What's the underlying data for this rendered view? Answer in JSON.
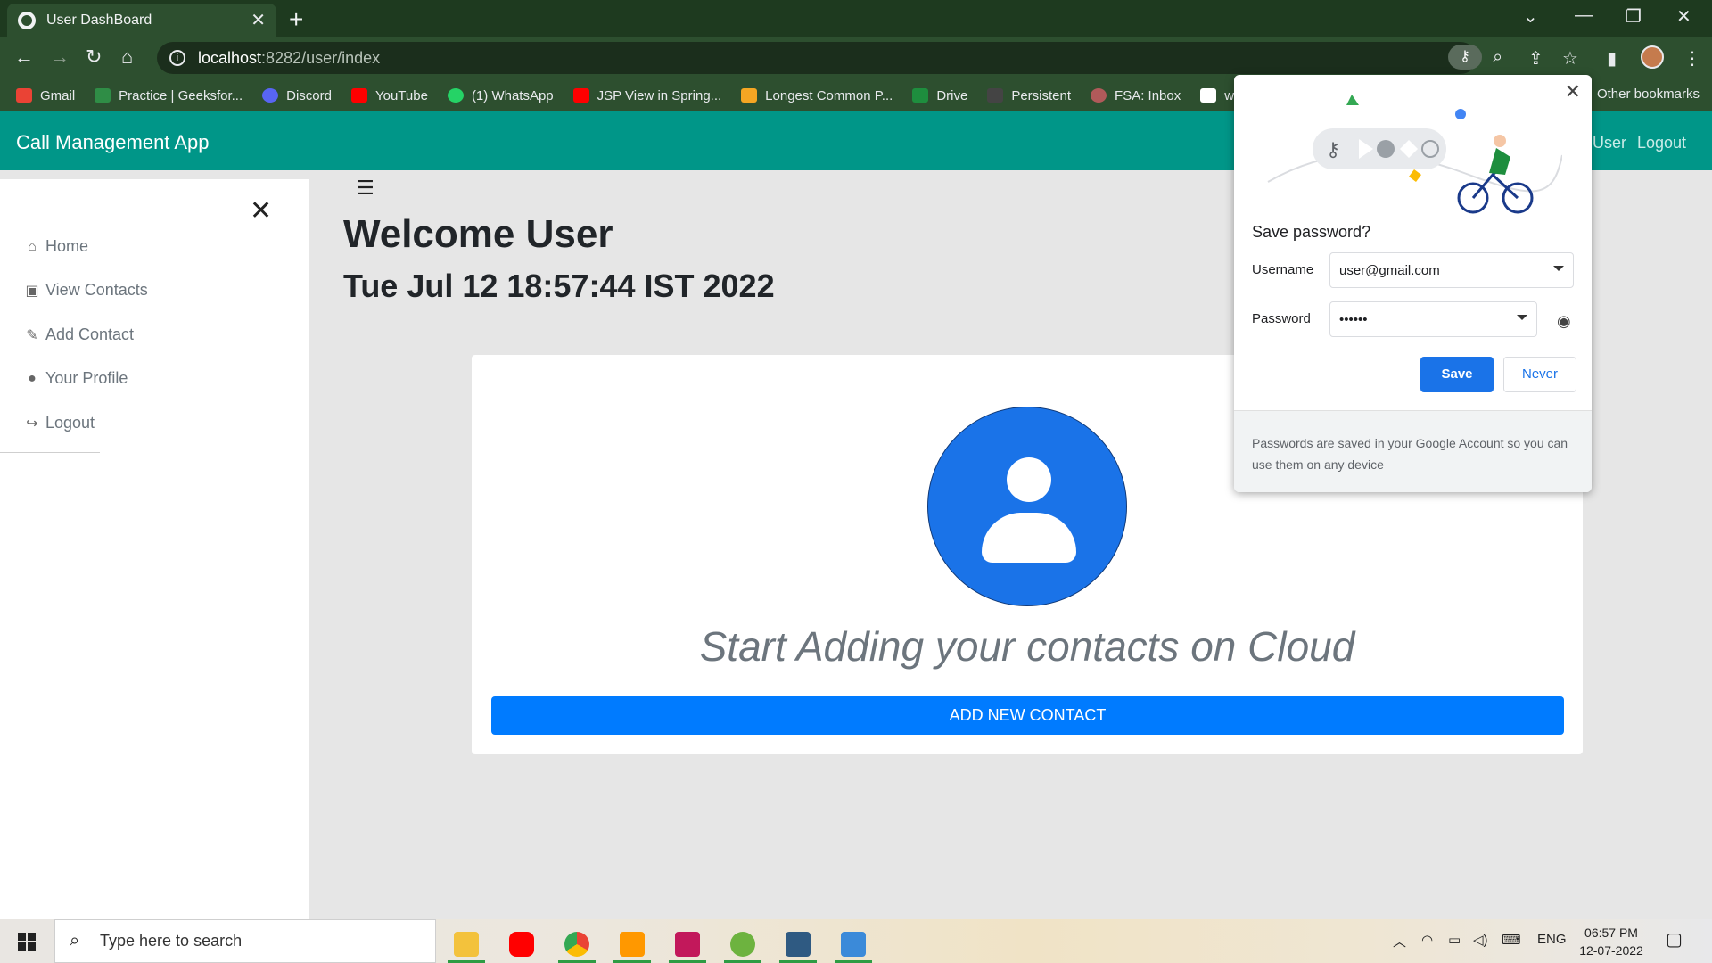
{
  "browser": {
    "tab_title": "User DashBoard",
    "url_host": "localhost",
    "url_path": ":8282/user/index",
    "bookmarks": [
      {
        "label": "Gmail",
        "color": "#ea4335"
      },
      {
        "label": "Practice | Geeksfor...",
        "color": "#2f8d46"
      },
      {
        "label": "Discord",
        "color": "#5865f2"
      },
      {
        "label": "YouTube",
        "color": "#ff0000"
      },
      {
        "label": "(1) WhatsApp",
        "color": "#25d366"
      },
      {
        "label": "JSP View in Spring...",
        "color": "#ff0000"
      },
      {
        "label": "Longest Common P...",
        "color": "#f5a623"
      },
      {
        "label": "Drive",
        "color": "#1e8e3e"
      },
      {
        "label": "Persistent",
        "color": "#444444"
      },
      {
        "label": "FSA: Inbox",
        "color": "#b05a5a"
      },
      {
        "label": "wi",
        "color": "#ffffff"
      }
    ],
    "other_bookmarks": "Other bookmarks"
  },
  "app": {
    "brand": "Call Management App",
    "nav_user": "User",
    "nav_logout": "Logout",
    "accent_color": "#009688"
  },
  "sidebar": {
    "items": [
      {
        "label": "Home",
        "icon": "home-icon"
      },
      {
        "label": "View Contacts",
        "icon": "contacts-icon"
      },
      {
        "label": "Add Contact",
        "icon": "pencil-icon"
      },
      {
        "label": "Your Profile",
        "icon": "user-circle-icon"
      },
      {
        "label": "Logout",
        "icon": "sign-out-icon"
      }
    ]
  },
  "main": {
    "welcome": "Welcome User",
    "datetime": "Tue Jul 12 18:57:44 IST 2022",
    "tagline": "Start Adding your contacts on Cloud",
    "add_button": "ADD NEW CONTACT"
  },
  "password_popup": {
    "title": "Save password?",
    "username_label": "Username",
    "username_value": "user@gmail.com",
    "password_label": "Password",
    "password_value": "••••••",
    "save_label": "Save",
    "never_label": "Never",
    "footer": "Passwords are saved in your Google Account so you can use them on any device"
  },
  "taskbar": {
    "search_placeholder": "Type here to search",
    "language": "ENG",
    "time": "06:57 PM",
    "date": "12-07-2022"
  }
}
